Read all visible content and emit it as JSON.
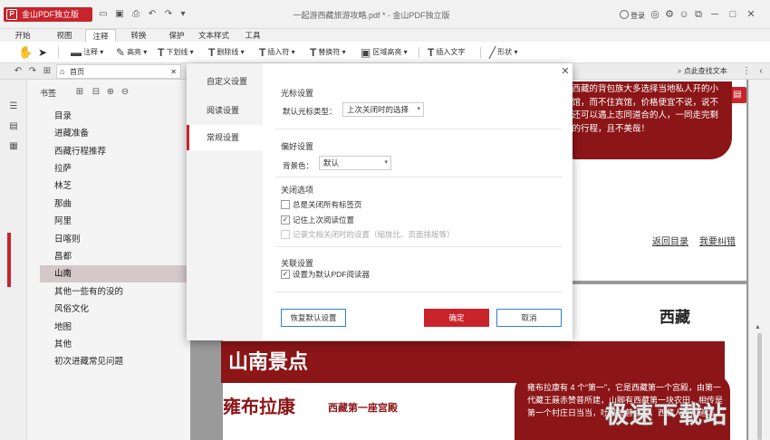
{
  "title_bar": {
    "app_name": "金山PDF独立版",
    "document_title": "一起游西藏旅游攻略.pdf * - 金山PDF独立版",
    "login_label": "登录"
  },
  "menu_tabs": [
    "开始",
    "视图",
    "注释",
    "转换",
    "保护",
    "文本样式",
    "工具"
  ],
  "active_menu_tab": "注释",
  "toolbar": {
    "note": "注释",
    "highlight": "高亮",
    "underline": "下划线",
    "strikethrough": "删除线",
    "insert_char": "插入符",
    "replace_char": "替换符",
    "area_highlight": "区域高亮",
    "insert_text": "插入文字",
    "shape": "形状"
  },
  "tabbar": {
    "home_tab": "首页",
    "search_text": "点此查找文本"
  },
  "bookmarks": {
    "header": "书签",
    "items": [
      "目录",
      "进藏准备",
      "西藏行程推荐",
      "拉萨",
      "林芝",
      "那曲",
      "阿里",
      "日喀则",
      "昌都",
      "山南",
      "其他一些有的没的",
      "风俗文化",
      "地图",
      "其他",
      "初次进藏常见问题"
    ],
    "selected": "山南"
  },
  "document": {
    "callout_top": "像西藏的背包族大多选择当地私人开的小旅馆，而不住宾馆，价格便宜不说，说不定还可以遇上志同道合的人，一同走完剩下的行程，且不美哉！",
    "link_back": "返回目录",
    "link_fix": "我要纠错",
    "region_heading": "西藏",
    "banner": "山南景点",
    "place_name": "雍布拉康",
    "place_subtitle": "西藏第一座宫殿",
    "callout_bottom": "雍布拉康有 4 个“第一”，它是西藏第一个宫殿，由第一代藏王聂赤赞普所建，山脚有西藏第一块农田，相传是第一个村庄日当当，吐蕃赞普之后，西藏人才知道怎"
  },
  "dialog": {
    "nav": [
      "自定义设置",
      "阅读设置",
      "常规设置"
    ],
    "active_nav": "常规设置",
    "cursor_section": "光标设置",
    "cursor_label": "默认光标类型：",
    "cursor_value": "上次关闭时的选择",
    "pref_section": "偏好设置",
    "bg_label": "背景色：",
    "bg_value": "默认",
    "close_section": "关闭选项",
    "close_opts": [
      {
        "label": "总是关闭所有标签页",
        "checked": false,
        "disabled": false
      },
      {
        "label": "记住上次阅读位置",
        "checked": true,
        "disabled": false
      },
      {
        "label": "记录文档关闭时的设置（缩放比、页面排版等）",
        "checked": false,
        "disabled": true
      }
    ],
    "assoc_section": "关联设置",
    "assoc_opt": {
      "label": "设置为默认PDF阅读器",
      "checked": true
    },
    "restore_button": "恢复默认设置",
    "ok_button": "确定",
    "cancel_button": "取消"
  },
  "watermark": "极速下载站",
  "colors": {
    "brand_red": "#c9232b",
    "doc_red": "#8b1517"
  }
}
